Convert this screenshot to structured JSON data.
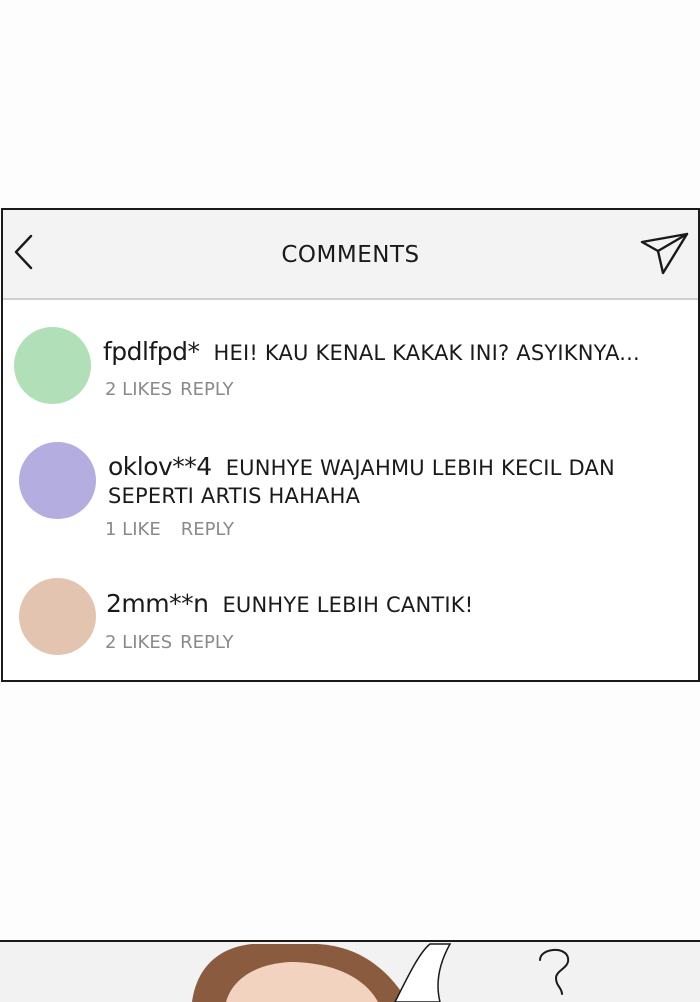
{
  "header": {
    "title": "COMMENTS"
  },
  "comments": [
    {
      "username": "fpdlfpd*",
      "text": "HEI! KAU KENAL KAKAK INI? ASYIKNYA...",
      "likes": "2 LIKES",
      "reply": "REPLY",
      "avatar_color": "#b1e0b8"
    },
    {
      "username": "oklov**4",
      "text": "EUNHYE WAJAHMU LEBIH KECIL DAN SEPERTI ARTIS HAHAHA",
      "likes": "1 LIKE",
      "reply": "REPLY",
      "avatar_color": "#b4addf"
    },
    {
      "username": "2mm**n",
      "text": "EUNHYE LEBIH CANTIK!",
      "likes": "2 LIKES",
      "reply": "REPLY",
      "avatar_color": "#e3c4b0"
    }
  ]
}
